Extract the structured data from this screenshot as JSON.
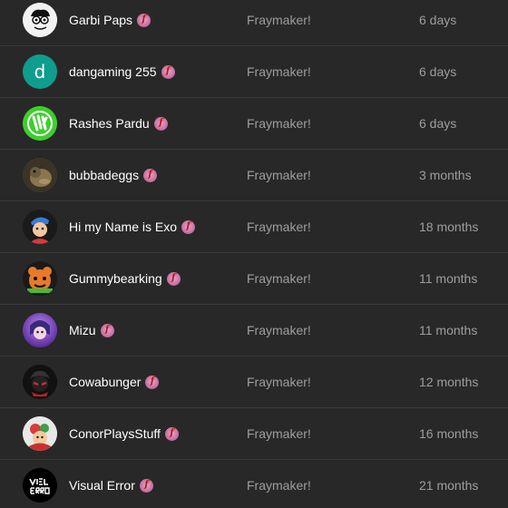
{
  "rows": [
    {
      "name": "Garbi Paps",
      "game": "Fraymaker!",
      "time": "6 days",
      "avatar": "cartoon-face-icon",
      "avatar_bg": "#f2f2f2"
    },
    {
      "name": "dangaming 255",
      "game": "Fraymaker!",
      "time": "6 days",
      "avatar": "letter-avatar-icon",
      "avatar_letter": "d",
      "avatar_bg": "#0f9d8e"
    },
    {
      "name": "Rashes Pardu",
      "game": "Fraymaker!",
      "time": "6 days",
      "avatar": "green-logo-icon",
      "avatar_bg": "#3ccf2c"
    },
    {
      "name": "bubbadeggs",
      "game": "Fraymaker!",
      "time": "3 months",
      "avatar": "animal-photo-icon",
      "avatar_bg": "#5a4a30"
    },
    {
      "name": "Hi my Name is Exo",
      "game": "Fraymaker!",
      "time": "18 months",
      "avatar": "character-blue-hat-icon",
      "avatar_bg": "#1a1a1a"
    },
    {
      "name": "Gummybearking",
      "game": "Fraymaker!",
      "time": "11 months",
      "avatar": "orange-bear-icon",
      "avatar_bg": "#2a1a10"
    },
    {
      "name": "Mizu",
      "game": "Fraymaker!",
      "time": "11 months",
      "avatar": "purple-character-icon",
      "avatar_bg": "#7b3fbf"
    },
    {
      "name": "Cowabunger",
      "game": "Fraymaker!",
      "time": "12 months",
      "avatar": "dark-red-character-icon",
      "avatar_bg": "#111111"
    },
    {
      "name": "ConorPlaysStuff",
      "game": "Fraymaker!",
      "time": "16 months",
      "avatar": "cartoon-red-character-icon",
      "avatar_bg": "#e8e8e8"
    },
    {
      "name": "Visual Error",
      "game": "Fraymaker!",
      "time": "21 months",
      "avatar": "visual-error-logo-icon",
      "avatar_bg": "#000000"
    }
  ],
  "badge_glyph": "f",
  "colors": {
    "background": "#282828",
    "divider": "#3a3a3a",
    "name_text": "#ffffff",
    "secondary_text": "#9e9e9e",
    "badge": "#c26a9a"
  }
}
